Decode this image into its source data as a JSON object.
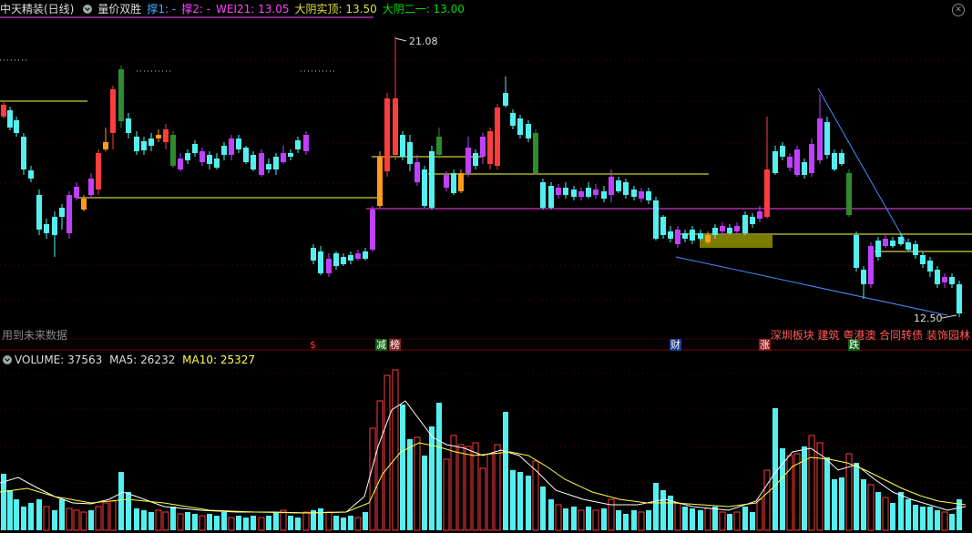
{
  "header": {
    "title": "中天精装(日线)",
    "indicator": "量价双胜",
    "c1": "撑1: -",
    "c2": "撑2: -",
    "wei": "WEI21: 13.05",
    "dyss": "大阴实顶: 13.50",
    "dye": "大阴二一: 13.00"
  },
  "colors": {
    "up": "#ff3d3d",
    "down": "#54f0f0",
    "wei": "#ff44ff",
    "yellow": "#ffff4a",
    "green": "#00e000"
  },
  "price": {
    "high_label": "21.08",
    "low_label": "12.50"
  },
  "note": "用到未来数据",
  "events": [
    {
      "label": "$",
      "color": "#ff3333"
    },
    {
      "label": "减",
      "color": "#ffffff",
      "bg": "#106010"
    },
    {
      "label": "榜",
      "color": "#ffffff",
      "bg": "#8a2020"
    },
    {
      "label": "财",
      "color": "#ffffff",
      "bg": "#1a3a8a"
    },
    {
      "label": "涨",
      "color": "#ffffff",
      "bg": "#8a1a1a"
    },
    {
      "label": "跌",
      "color": "#ffffff",
      "bg": "#106010"
    }
  ],
  "news": "深圳板块 建筑 粤港澳 合同转债 装饰园林",
  "volume": {
    "label": "VOLUME: 37563",
    "ma5": "MA5: 26232",
    "ma10": "MA10: 25327"
  }
}
